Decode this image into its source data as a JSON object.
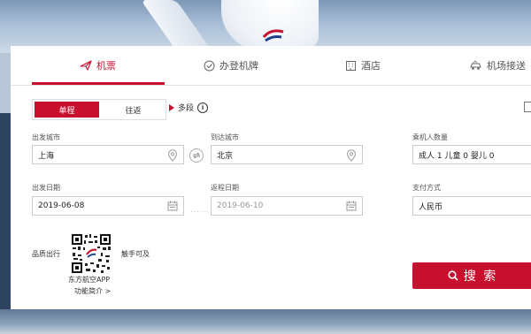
{
  "tabs": [
    {
      "label": "机票",
      "icon": "plane-icon"
    },
    {
      "label": "办登机牌",
      "icon": "check-in-icon"
    },
    {
      "label": "酒店",
      "icon": "hotel-icon"
    },
    {
      "label": "机场接送",
      "icon": "car-icon"
    }
  ],
  "trip_type": {
    "one_way": "单程",
    "round_trip": "往返",
    "multi_segment": "多段"
  },
  "form": {
    "from_label": "出发城市",
    "from_value": "上海",
    "to_label": "到达城市",
    "to_value": "北京",
    "passengers_label": "乘机人数量",
    "passengers_value": "成人 1  儿童 0  婴儿 0",
    "depart_label": "出发日期",
    "depart_value": "2019-06-08",
    "return_label": "返程日期",
    "return_value": "2019-06-10",
    "payment_label": "支付方式",
    "payment_value": "人民币",
    "date_separator": "......"
  },
  "promo": {
    "left_text": "品质出行",
    "right_text": "触手可及",
    "app_name": "东方航空APP",
    "intro_link": "功能简介 >"
  },
  "search_label": "搜 索",
  "colors": {
    "accent": "#c8102e"
  }
}
